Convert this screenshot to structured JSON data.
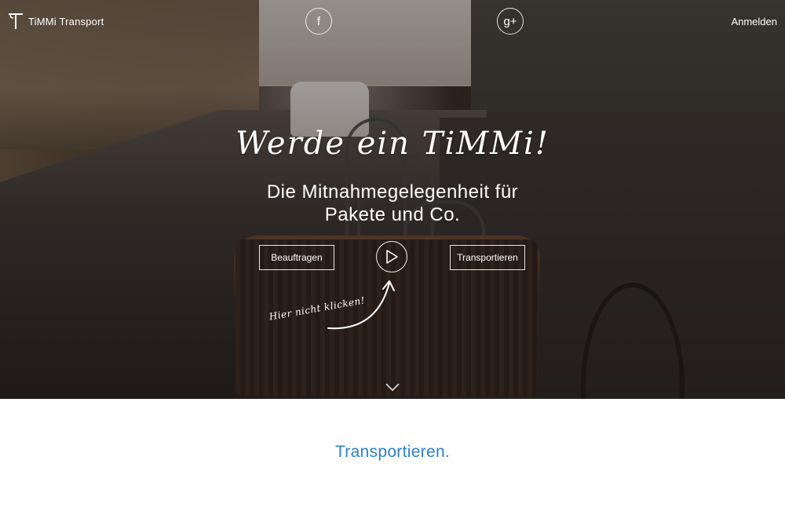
{
  "header": {
    "brand_name": "TiMMi Transport",
    "signin_label": "Anmelden",
    "social": [
      {
        "name": "facebook",
        "glyph": "f"
      },
      {
        "name": "google-plus",
        "glyph": "g+"
      }
    ]
  },
  "hero": {
    "headline": "Werde ein TiMMi!",
    "subline_line1": "Die Mitnahmegelegenheit für",
    "subline_line2": "Pakete und Co.",
    "order_button": "Beauftragen",
    "transport_button": "Transportieren",
    "hint": "Hier nicht klicken!"
  },
  "main": {
    "section_title": "Transportieren."
  },
  "colors": {
    "accent": "#2b7fd1",
    "text_on_hero": "#ffffff"
  },
  "icons": [
    "logo-icon",
    "facebook-icon",
    "google-plus-icon",
    "play-icon",
    "curved-arrow-icon",
    "chevron-down-icon"
  ]
}
